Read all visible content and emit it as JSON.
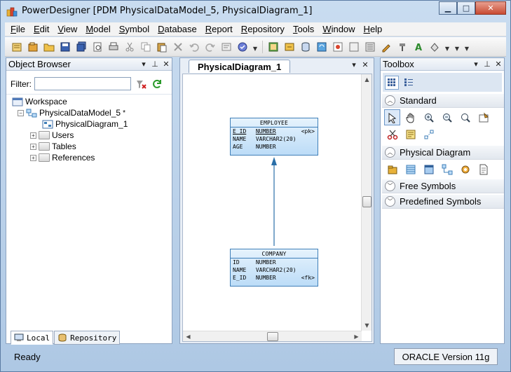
{
  "window": {
    "title": "PowerDesigner [PDM PhysicalDataModel_5, PhysicalDiagram_1]"
  },
  "menu": [
    {
      "ul": "F",
      "rest": "ile"
    },
    {
      "ul": "E",
      "rest": "dit"
    },
    {
      "ul": "V",
      "rest": "iew"
    },
    {
      "ul": "M",
      "rest": "odel"
    },
    {
      "ul": "S",
      "rest": "ymbol"
    },
    {
      "ul": "D",
      "rest": "atabase"
    },
    {
      "ul": "R",
      "rest": "eport"
    },
    {
      "ul": "R",
      "rest": "epository"
    },
    {
      "ul": "T",
      "rest": "ools"
    },
    {
      "ul": "W",
      "rest": "indow"
    },
    {
      "ul": "H",
      "rest": "elp"
    }
  ],
  "object_browser": {
    "title": "Object Browser",
    "filter_label": "Filter:",
    "filter_value": "",
    "tree": {
      "workspace": "Workspace",
      "model": "PhysicalDataModel_5",
      "model_modified_mark": "*",
      "diagram": "PhysicalDiagram_1",
      "folders": [
        "Users",
        "Tables",
        "References"
      ]
    },
    "tabs": {
      "local": "Local",
      "repository": "Repository"
    }
  },
  "diagram": {
    "tab_label": "PhysicalDiagram_1",
    "entities": {
      "employee": {
        "name": "EMPLOYEE",
        "attributes": [
          {
            "name": "E_ID",
            "type": "NUMBER",
            "key": "<pk>"
          },
          {
            "name": "NAME",
            "type": "VARCHAR2(20)",
            "key": ""
          },
          {
            "name": "AGE",
            "type": "NUMBER",
            "key": ""
          }
        ]
      },
      "company": {
        "name": "COMPANY",
        "attributes": [
          {
            "name": "ID",
            "type": "NUMBER",
            "key": ""
          },
          {
            "name": "NAME",
            "type": "VARCHAR2(20)",
            "key": ""
          },
          {
            "name": "E_ID",
            "type": "NUMBER",
            "key": "<fk>"
          }
        ]
      }
    }
  },
  "toolbox": {
    "title": "Toolbox",
    "categories": {
      "standard": "Standard",
      "physical": "Physical Diagram",
      "free": "Free Symbols",
      "predefined": "Predefined Symbols"
    }
  },
  "status": {
    "left": "Ready",
    "right": "ORACLE Version 11g"
  },
  "colors": {
    "entity_border": "#3f7fb8",
    "entity_fill": "#bcdcf7",
    "link": "#2a6fa8"
  }
}
